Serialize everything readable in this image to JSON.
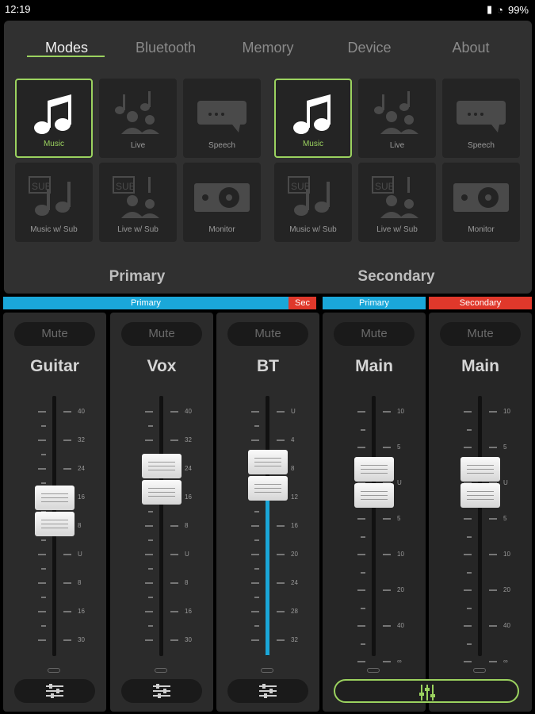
{
  "status": {
    "time": "12:19",
    "battery": "99%"
  },
  "tabs": [
    "Modes",
    "Bluetooth",
    "Memory",
    "Device",
    "About"
  ],
  "primary_modes": [
    {
      "label": "Music",
      "icon": "music-icon",
      "selected": true
    },
    {
      "label": "Live",
      "icon": "live-icon",
      "selected": false
    },
    {
      "label": "Speech",
      "icon": "speech-icon",
      "selected": false
    },
    {
      "label": "Music w/ Sub",
      "icon": "music-sub-icon",
      "selected": false
    },
    {
      "label": "Live w/ Sub",
      "icon": "live-sub-icon",
      "selected": false
    },
    {
      "label": "Monitor",
      "icon": "monitor-icon",
      "selected": false
    }
  ],
  "secondary_modes": [
    {
      "label": "Music",
      "icon": "music-icon",
      "selected": true
    },
    {
      "label": "Live",
      "icon": "live-icon",
      "selected": false
    },
    {
      "label": "Speech",
      "icon": "speech-icon",
      "selected": false
    },
    {
      "label": "Music w/ Sub",
      "icon": "music-sub-icon",
      "selected": false
    },
    {
      "label": "Live w/ Sub",
      "icon": "live-sub-icon",
      "selected": false
    },
    {
      "label": "Monitor",
      "icon": "monitor-icon",
      "selected": false
    }
  ],
  "section_labels": {
    "primary": "Primary",
    "secondary": "Secondary"
  },
  "bus_labels": {
    "primary": "Primary",
    "sec": "Sec",
    "primary2": "Primary",
    "secondary": "Secondary"
  },
  "colors": {
    "accent": "#9bd25f",
    "primary_bus": "#1aa7d9",
    "secondary_bus": "#e0382b"
  },
  "mute_label": "Mute",
  "channels": [
    {
      "name": "Guitar",
      "scale": [
        "40",
        "32",
        "24",
        "16",
        "8",
        "U",
        "8",
        "16",
        "30"
      ]
    },
    {
      "name": "Vox",
      "scale": [
        "40",
        "32",
        "24",
        "16",
        "8",
        "U",
        "8",
        "16",
        "30"
      ]
    },
    {
      "name": "BT",
      "scale": [
        "U",
        "4",
        "8",
        "12",
        "16",
        "20",
        "24",
        "28",
        "32"
      ]
    },
    {
      "name": "Main",
      "scale": [
        "10",
        "5",
        "U",
        "5",
        "10",
        "20",
        "40",
        "∞"
      ]
    },
    {
      "name": "Main",
      "scale": [
        "10",
        "5",
        "U",
        "5",
        "10",
        "20",
        "40",
        "∞"
      ]
    }
  ]
}
